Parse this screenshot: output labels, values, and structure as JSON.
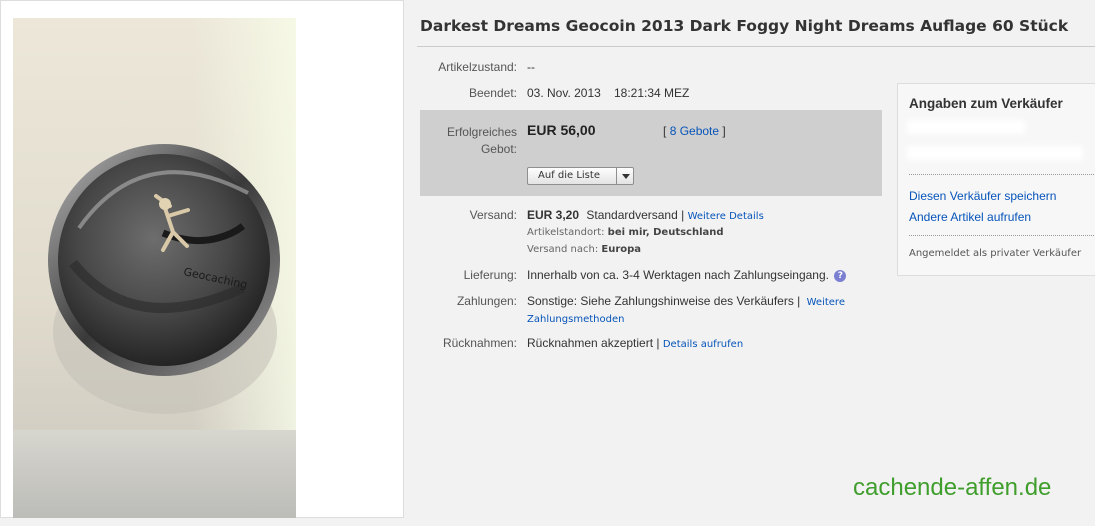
{
  "listing": {
    "title": "Darkest Dreams Geocoin 2013 Dark Foggy Night Dreams Auflage 60 Stück",
    "photo_coin_text": "Geocaching"
  },
  "details": {
    "condition_label": "Artikelzustand:",
    "condition_value": "--",
    "ended_label": "Beendet:",
    "ended_date": "03. Nov. 2013",
    "ended_time": "18:21:34 MEZ",
    "bid_label_line1": "Erfolgreiches",
    "bid_label_line2": "Gebot:",
    "price": "EUR 56,00",
    "bids_open": "[",
    "bids_link": "8 Gebote",
    "bids_close": "]",
    "watch_button": "Auf die Liste",
    "shipping_label": "Versand:",
    "shipping_price": "EUR 3,20",
    "shipping_method": "Standardversand |",
    "shipping_details_link": "Weitere Details",
    "location_label": "Artikelstandort:",
    "location_value": "bei mir, Deutschland",
    "ships_to_label": "Versand nach:",
    "ships_to_value": "Europa",
    "delivery_label": "Lieferung:",
    "delivery_value": "Innerhalb von ca. 3-4 Werktagen nach Zahlungseingang.",
    "help_icon_glyph": "?",
    "payment_label": "Zahlungen:",
    "payment_value": "Sonstige: Siehe Zahlungshinweise des Verkäufers  |",
    "payment_link_line1": "Weitere",
    "payment_link_line2": "Zahlungsmethoden",
    "returns_label": "Rücknahmen:",
    "returns_value": "Rücknahmen akzeptiert |",
    "returns_link": "Details aufrufen"
  },
  "seller": {
    "title": "Angaben zum Verkäufer",
    "save_link": "Diesen Verkäufer speichern",
    "other_items_link": "Andere Artikel aufrufen",
    "status": "Angemeldet als privater Verkäufer"
  },
  "watermark": "cachende-affen.de",
  "colors": {
    "link": "#0654ba",
    "bid_box": "#cfcfcf",
    "watermark": "#3f9e2c",
    "help_icon": "#7a7fd1"
  }
}
